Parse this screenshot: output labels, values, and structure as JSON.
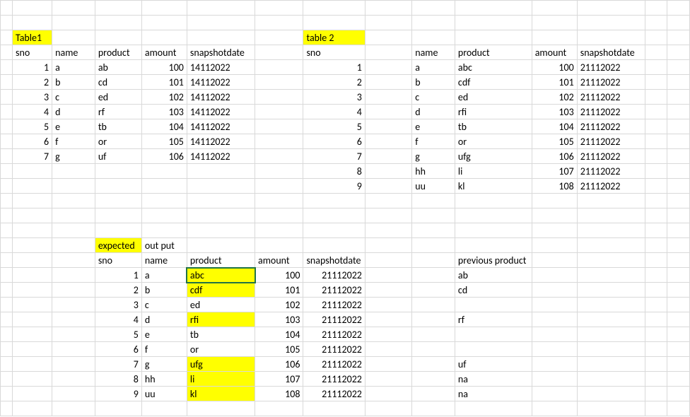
{
  "labels": {
    "table1": "Table1",
    "table2": "table 2",
    "expected": "expected",
    "output": "out put",
    "previous_product": "previous product"
  },
  "headers": {
    "sno": "sno",
    "name": "name",
    "product": "product",
    "amount": "amount",
    "snapshotdate": "snapshotdate"
  },
  "table1": {
    "rows": [
      {
        "sno": "1",
        "name": "a",
        "product": "ab",
        "amount": "100",
        "snapshotdate": "14112022"
      },
      {
        "sno": "2",
        "name": "b",
        "product": "cd",
        "amount": "101",
        "snapshotdate": "14112022"
      },
      {
        "sno": "3",
        "name": "c",
        "product": "ed",
        "amount": "102",
        "snapshotdate": "14112022"
      },
      {
        "sno": "4",
        "name": "d",
        "product": "rf",
        "amount": "103",
        "snapshotdate": "14112022"
      },
      {
        "sno": "5",
        "name": "e",
        "product": "tb",
        "amount": "104",
        "snapshotdate": "14112022"
      },
      {
        "sno": "6",
        "name": "f",
        "product": "or",
        "amount": "105",
        "snapshotdate": "14112022"
      },
      {
        "sno": "7",
        "name": "g",
        "product": "uf",
        "amount": "106",
        "snapshotdate": "14112022"
      }
    ]
  },
  "table2": {
    "rows": [
      {
        "sno": "1",
        "name": "a",
        "product": "abc",
        "amount": "100",
        "snapshotdate": "21112022"
      },
      {
        "sno": "2",
        "name": "b",
        "product": "cdf",
        "amount": "101",
        "snapshotdate": "21112022"
      },
      {
        "sno": "3",
        "name": "c",
        "product": "ed",
        "amount": "102",
        "snapshotdate": "21112022"
      },
      {
        "sno": "4",
        "name": "d",
        "product": "rfi",
        "amount": "103",
        "snapshotdate": "21112022"
      },
      {
        "sno": "5",
        "name": "e",
        "product": "tb",
        "amount": "104",
        "snapshotdate": "21112022"
      },
      {
        "sno": "6",
        "name": "f",
        "product": "or",
        "amount": "105",
        "snapshotdate": "21112022"
      },
      {
        "sno": "7",
        "name": "g",
        "product": "ufg",
        "amount": "106",
        "snapshotdate": "21112022"
      },
      {
        "sno": "8",
        "name": "hh",
        "product": "li",
        "amount": "107",
        "snapshotdate": "21112022"
      },
      {
        "sno": "9",
        "name": "uu",
        "product": "kl",
        "amount": "108",
        "snapshotdate": "21112022"
      }
    ]
  },
  "expected": {
    "rows": [
      {
        "sno": "1",
        "name": "a",
        "product": "abc",
        "amount": "100",
        "snapshotdate": "21112022",
        "prev": "ab",
        "hl": true
      },
      {
        "sno": "2",
        "name": "b",
        "product": "cdf",
        "amount": "101",
        "snapshotdate": "21112022",
        "prev": "cd",
        "hl": true
      },
      {
        "sno": "3",
        "name": "c",
        "product": "ed",
        "amount": "102",
        "snapshotdate": "21112022",
        "prev": "",
        "hl": false
      },
      {
        "sno": "4",
        "name": "d",
        "product": "rfi",
        "amount": "103",
        "snapshotdate": "21112022",
        "prev": "rf",
        "hl": true
      },
      {
        "sno": "5",
        "name": "e",
        "product": "tb",
        "amount": "104",
        "snapshotdate": "21112022",
        "prev": "",
        "hl": false
      },
      {
        "sno": "6",
        "name": "f",
        "product": "or",
        "amount": "105",
        "snapshotdate": "21112022",
        "prev": "",
        "hl": false
      },
      {
        "sno": "7",
        "name": "g",
        "product": "ufg",
        "amount": "106",
        "snapshotdate": "21112022",
        "prev": "uf",
        "hl": true
      },
      {
        "sno": "8",
        "name": "hh",
        "product": "li",
        "amount": "107",
        "snapshotdate": "21112022",
        "prev": "na",
        "hl": true
      },
      {
        "sno": "9",
        "name": "uu",
        "product": "kl",
        "amount": "108",
        "snapshotdate": "21112022",
        "prev": "na",
        "hl": true
      }
    ]
  }
}
